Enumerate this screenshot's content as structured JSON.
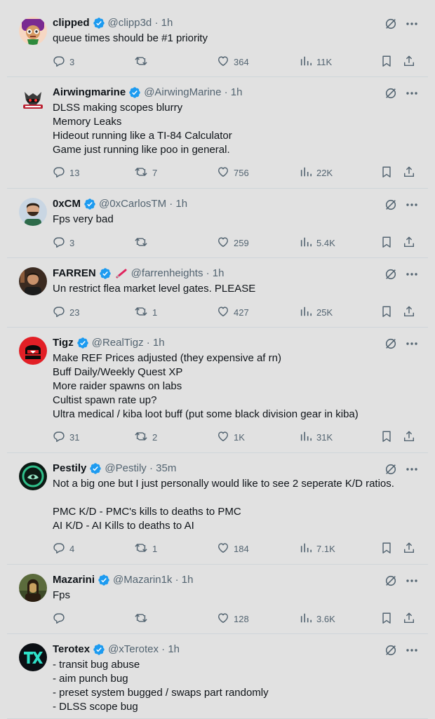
{
  "colors": {
    "accent": "#1d9bf0",
    "muted": "#536471",
    "text": "#0f1419",
    "background": "#e1e1e1"
  },
  "icons": {
    "verified": "verified-badge-icon",
    "grok": "grok-icon",
    "more": "more-icon",
    "reply": "reply-icon",
    "retweet": "retweet-icon",
    "like": "like-icon",
    "views": "views-icon",
    "bookmark": "bookmark-icon",
    "share": "share-icon"
  },
  "tweets": [
    {
      "name": "clipped",
      "handle": "@clipp3d",
      "time": "· 1h",
      "lines": [
        "queue times should be #1 priority"
      ],
      "replies": "3",
      "retweets": "",
      "likes": "364",
      "views": "11K"
    },
    {
      "name": "Airwingmarine",
      "handle": "@AirwingMarine",
      "time": "· 1h",
      "lines": [
        "DLSS making scopes blurry",
        "Memory Leaks",
        "Hideout running like a TI-84 Calculator",
        "Game just running like poo in general."
      ],
      "replies": "13",
      "retweets": "7",
      "likes": "756",
      "views": "22K"
    },
    {
      "name": "0xCM",
      "handle": "@0xCarlosTM",
      "time": "· 1h",
      "lines": [
        "Fps very bad"
      ],
      "replies": "3",
      "retweets": "",
      "likes": "259",
      "views": "5.4K"
    },
    {
      "name": "FARREN",
      "handle": "@farrenheights",
      "time": "· 1h",
      "lines": [
        "Un restrict flea market level gates. PLEASE"
      ],
      "replies": "23",
      "retweets": "1",
      "likes": "427",
      "views": "25K"
    },
    {
      "name": "Tigz",
      "handle": "@RealTigz",
      "time": "· 1h",
      "lines": [
        "Make REF Prices adjusted (they expensive af rn)",
        "Buff Daily/Weekly Quest XP",
        "More raider spawns on labs",
        "Cultist spawn rate up?",
        "Ultra medical / kiba loot buff (put some black division gear in kiba)"
      ],
      "replies": "31",
      "retweets": "2",
      "likes": "1K",
      "views": "31K"
    },
    {
      "name": "Pestily",
      "handle": "@Pestily",
      "time": "· 35m",
      "lines": [
        "Not a big one but I just personally would like to see 2 seperate K/D ratios.",
        "",
        "PMC K/D - PMC's kills to deaths to PMC",
        "AI K/D - AI Kills to deaths to AI"
      ],
      "replies": "4",
      "retweets": "1",
      "likes": "184",
      "views": "7.1K"
    },
    {
      "name": "Mazarini",
      "handle": "@Mazarin1k",
      "time": "· 1h",
      "lines": [
        "Fps"
      ],
      "replies": "",
      "retweets": "",
      "likes": "128",
      "views": "3.6K"
    },
    {
      "name": "Terotex",
      "handle": "@xTerotex",
      "time": "· 1h",
      "lines": [
        "- transit bug abuse",
        "- aim punch bug",
        "- preset system bugged / swaps part randomly",
        "- DLSS scope bug"
      ],
      "replies": "",
      "retweets": "",
      "likes": "",
      "views": ""
    }
  ]
}
